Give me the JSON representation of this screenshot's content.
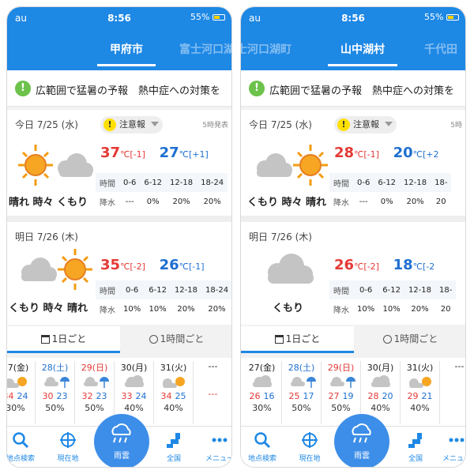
{
  "screens": [
    {
      "status": {
        "carrier": "au",
        "time": "8:56",
        "battery": "55%"
      },
      "city_tabs": [
        "甲府市",
        "富士河口湖"
      ],
      "active_city": "甲府市",
      "notice": "広範囲で猛暑の予報　熱中症への対策を",
      "today": {
        "label": "今日 7/25 (水)",
        "alert": "注意報",
        "issued": "5時発表",
        "weather": "晴れ 時々 くもり",
        "icon": "sun-then-cloud-icon",
        "high": "37",
        "high_diff": "[-1]",
        "low": "27",
        "low_diff": "[+1]",
        "unit": "℃",
        "periods": [
          "時間",
          "0-6",
          "6-12",
          "12-18",
          "18-24"
        ],
        "precip": [
          "降水",
          "---",
          "0%",
          "20%",
          "20%"
        ]
      },
      "tomorrow": {
        "label": "明日 7/26 (木)",
        "weather": "くもり 時々 晴れ",
        "icon": "cloud-then-sun-icon",
        "high": "35",
        "high_diff": "[-2]",
        "low": "26",
        "low_diff": "[-1]",
        "unit": "℃",
        "periods": [
          "時間",
          "0-6",
          "6-12",
          "12-18",
          "18-24"
        ],
        "precip": [
          "降水",
          "10%",
          "10%",
          "20%",
          "20%"
        ]
      },
      "view_tabs": [
        "1日ごと",
        "1時間ごと"
      ],
      "forecast": [
        {
          "date": "27(金)",
          "hi": "34",
          "lo": "24",
          "pop": "30%"
        },
        {
          "date": "28(土)",
          "hi": "30",
          "lo": "23",
          "pop": "50%"
        },
        {
          "date": "29(日)",
          "hi": "32",
          "lo": "23",
          "pop": "50%"
        },
        {
          "date": "30(月)",
          "hi": "33",
          "lo": "24",
          "pop": "40%"
        },
        {
          "date": "31(火)",
          "hi": "34",
          "lo": "25",
          "pop": "40%"
        },
        {
          "date": "---",
          "hi": "---",
          "lo": "",
          "pop": ""
        }
      ],
      "nav": [
        "地点検索",
        "現在地",
        "雨雲",
        "全国",
        "メニュー"
      ]
    },
    {
      "status": {
        "carrier": "au",
        "time": "8:56",
        "battery": "55%"
      },
      "city_tabs": [
        "士河口湖町",
        "山中湖村",
        "千代田"
      ],
      "active_city": "山中湖村",
      "notice": "広範囲で猛暑の予報　熱中症への対策を",
      "today": {
        "label": "今日 7/25 (水)",
        "alert": "注意報",
        "issued": "5時",
        "weather": "くもり 時々 晴れ",
        "icon": "cloud-then-sun-icon",
        "high": "28",
        "high_diff": "[-1]",
        "low": "20",
        "low_diff": "[+2",
        "unit": "℃",
        "periods": [
          "時間",
          "0-6",
          "6-12",
          "12-18",
          "18-"
        ],
        "precip": [
          "降水",
          "---",
          "0%",
          "20%",
          "20"
        ]
      },
      "tomorrow": {
        "label": "明日 7/26 (木)",
        "weather": "くもり",
        "icon": "cloud-icon",
        "high": "26",
        "high_diff": "[-2]",
        "low": "18",
        "low_diff": "[-2",
        "unit": "℃",
        "periods": [
          "時間",
          "0-6",
          "6-12",
          "12-18",
          "18-"
        ],
        "precip": [
          "降水",
          "10%",
          "10%",
          "20%",
          "20"
        ]
      },
      "view_tabs": [
        "1日ごと",
        "1時間ごと"
      ],
      "forecast": [
        {
          "date": "27(金)",
          "hi": "26",
          "lo": "16",
          "pop": "30%"
        },
        {
          "date": "28(土)",
          "hi": "25",
          "lo": "17",
          "pop": "50%"
        },
        {
          "date": "29(日)",
          "hi": "27",
          "lo": "19",
          "pop": "50%"
        },
        {
          "date": "30(月)",
          "hi": "28",
          "lo": "20",
          "pop": "40%"
        },
        {
          "date": "31(火)",
          "hi": "29",
          "lo": "21",
          "pop": "40%"
        },
        {
          "date": "---",
          "hi": "",
          "lo": "",
          "pop": ""
        }
      ],
      "nav": [
        "地点検索",
        "現在地",
        "雨雲",
        "全国",
        "メニュー"
      ]
    }
  ],
  "colors": {
    "brand_blue": "#1e88e5",
    "high_red": "#e53935",
    "low_blue": "#1e6fd0",
    "notice_green": "#6cc24a",
    "alert_yellow": "#ffe000"
  }
}
